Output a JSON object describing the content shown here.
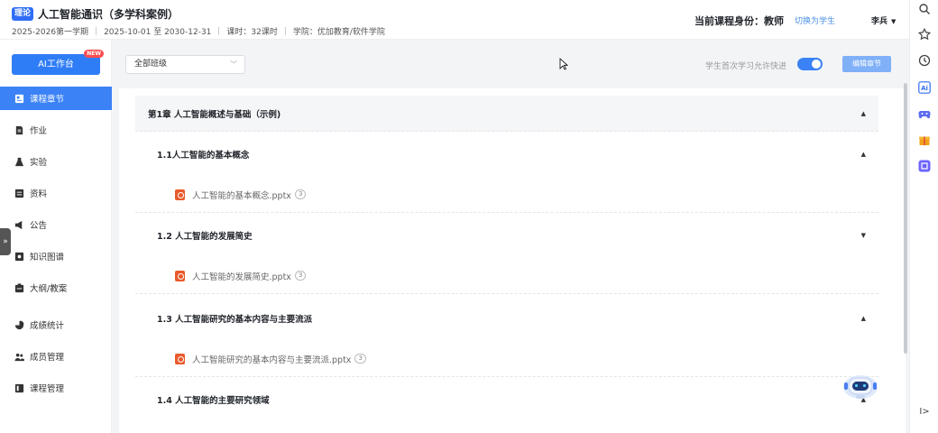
{
  "header": {
    "badge": "理论",
    "title": "人工智能通识（多学科案例）",
    "term": "2025-2026第一学期",
    "dates": "2025-10-01 至 2030-12-31",
    "hours": "课时：32课时",
    "college": "学院：优加教育/软件学院",
    "identity": "当前课程身份：教师",
    "switch_link": "切换为学生",
    "user": "李兵"
  },
  "sidebar": {
    "ai_button": "AI工作台",
    "ai_new": "NEW",
    "items": [
      {
        "label": "课程章节",
        "icon": "chapter-icon"
      },
      {
        "label": "作业",
        "icon": "homework-icon"
      },
      {
        "label": "实验",
        "icon": "flask-icon"
      },
      {
        "label": "资料",
        "icon": "material-icon"
      },
      {
        "label": "公告",
        "icon": "megaphone-icon"
      },
      {
        "label": "知识图谱",
        "icon": "graph-icon"
      },
      {
        "label": "大纲/教案",
        "icon": "outline-icon"
      },
      {
        "label": "成绩统计",
        "icon": "pie-icon"
      },
      {
        "label": "成员管理",
        "icon": "members-icon"
      },
      {
        "label": "课程管理",
        "icon": "course-manage-icon"
      }
    ],
    "collapse_glyph": "»"
  },
  "toolbar": {
    "class_select": "全部班级",
    "allow_label": "学生首次学习允许快进",
    "edit_button": "编辑章节"
  },
  "outline": {
    "chapter": "第1章 人工智能概述与基础（示例)",
    "sections": [
      {
        "title": "1.1人工智能的基本概念",
        "file": "人工智能的基本概念.pptx",
        "count": "3"
      },
      {
        "title": "1.2 人工智能的发展简史",
        "file": "人工智能的发展简史.pptx",
        "count": "3"
      },
      {
        "title": "1.3 人工智能研究的基本内容与主要流派",
        "file": "人工智能研究的基本内容与主要流派.pptx",
        "count": "3"
      },
      {
        "title": "1.4 人工智能的主要研究领域"
      }
    ]
  },
  "rail": {
    "ai_label": "Ai",
    "expand_glyph": "I>"
  },
  "colors": {
    "accent": "#3b82f6",
    "ppt": "#e85a2c"
  }
}
